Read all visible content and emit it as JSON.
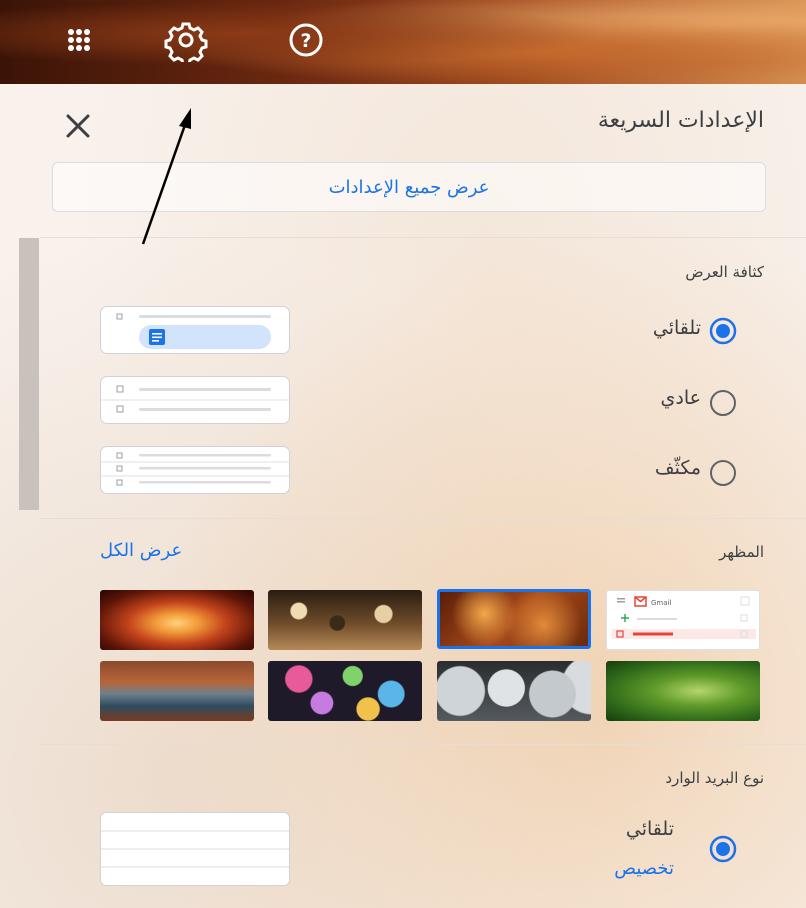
{
  "header": {
    "apps_icon": "apps-grid-icon",
    "settings_icon": "gear-icon",
    "help_icon": "help-circle-icon"
  },
  "quick_settings": {
    "title": "الإعدادات السريعة",
    "all_settings_label": "عرض جميع الإعدادات"
  },
  "density": {
    "label": "كثافة العرض",
    "options": [
      {
        "label": "تلقائي",
        "selected": true
      },
      {
        "label": "عادي",
        "selected": false
      },
      {
        "label": "مكثّف",
        "selected": false
      }
    ]
  },
  "theme": {
    "label": "المظهر",
    "view_all": "عرض الكل",
    "preview_app_name": "Gmail"
  },
  "inbox_type": {
    "label": "نوع البريد الوارد",
    "option_label": "تلقائي",
    "customize": "تخصيص"
  },
  "colors": {
    "accent": "#1a73e8",
    "text": "#3c4043"
  }
}
